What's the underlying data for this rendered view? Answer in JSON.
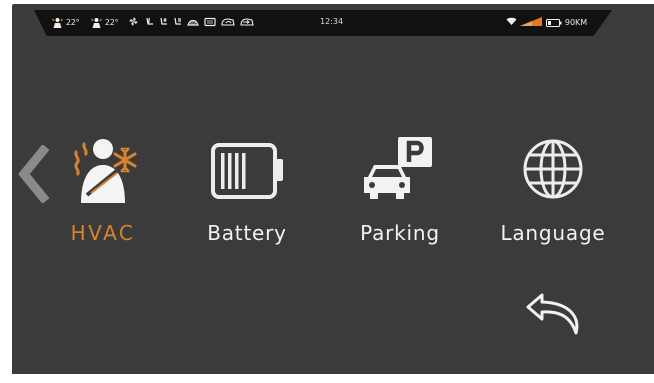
{
  "status_bar": {
    "driver_temp": "22°",
    "passenger_temp": "22°",
    "time": "12:34",
    "range": "90KM",
    "icons": [
      "driver-heat-icon",
      "passenger-heat-icon",
      "fan-icon",
      "seat-heat-icon",
      "seat-cool-icon",
      "seat-vent-icon",
      "defrost-front-icon",
      "defrost-rear-icon",
      "recirculation-icon",
      "fresh-air-icon",
      "wifi-icon",
      "signal-icon",
      "battery-icon"
    ]
  },
  "menu": {
    "items": [
      {
        "label": "HVAC",
        "icon": "hvac-icon",
        "active": true
      },
      {
        "label": "Battery",
        "icon": "battery-icon",
        "active": false
      },
      {
        "label": "Parking",
        "icon": "parking-icon",
        "active": false
      },
      {
        "label": "Language",
        "icon": "globe-icon",
        "active": false
      }
    ]
  },
  "colors": {
    "screen_bg": "#3b3b3c",
    "status_bar_bg": "#111111",
    "accent": "#d9832c",
    "text": "#f2f2f2"
  }
}
